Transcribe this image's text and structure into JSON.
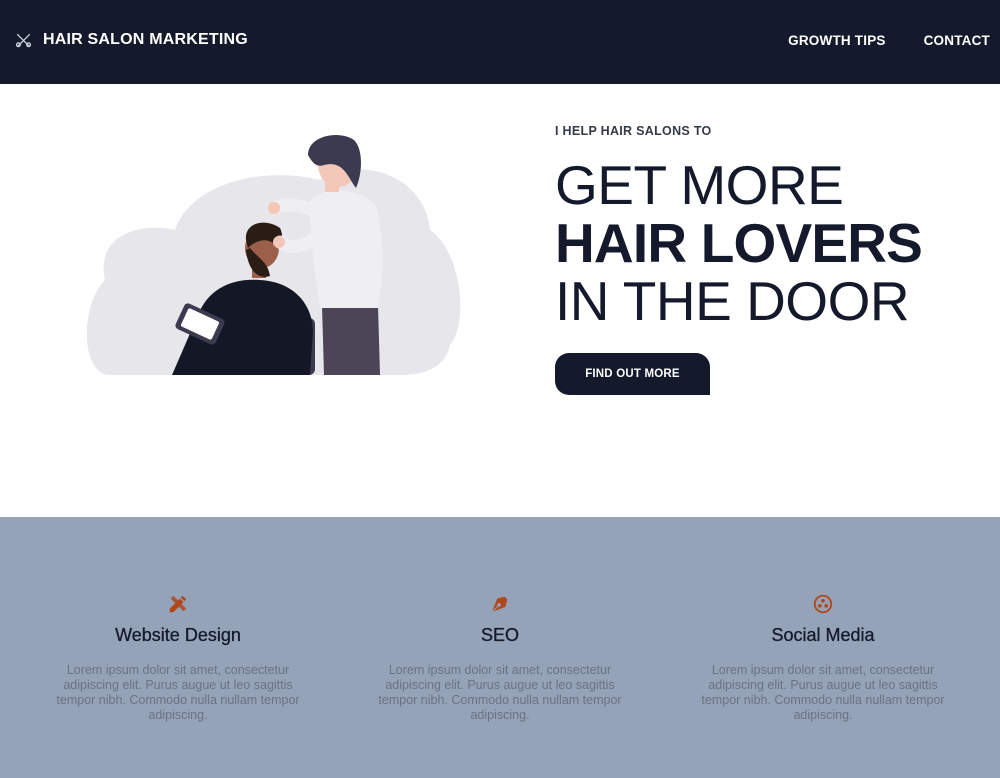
{
  "brand": {
    "name": "HAIR SALON MARKETING",
    "icon": "scissors-icon"
  },
  "nav": {
    "items": [
      {
        "label": "GROWTH TIPS"
      },
      {
        "label": "CONTACT"
      }
    ]
  },
  "hero": {
    "eyebrow": "I HELP HAIR SALONS TO",
    "headline": {
      "line1": "GET MORE",
      "line2": "HAIR LOVERS",
      "line3": "IN THE DOOR"
    },
    "cta_label": "FIND OUT MORE"
  },
  "services": [
    {
      "icon": "pencil-ruler-icon",
      "title": "Website Design",
      "description": "Lorem ipsum dolor sit amet, consectetur adipiscing elit. Purus augue ut leo sagittis tempor nibh. Commodo nulla nullam tempor adipiscing."
    },
    {
      "icon": "pen-nib-icon",
      "title": "SEO",
      "description": "Lorem ipsum dolor sit amet, consectetur adipiscing elit. Purus augue ut leo sagittis tempor nibh. Commodo nulla nullam tempor adipiscing."
    },
    {
      "icon": "people-circle-icon",
      "title": "Social Media",
      "description": "Lorem ipsum dolor sit amet, consectetur adipiscing elit. Purus augue ut leo sagittis tempor nibh. Commodo nulla nullam tempor adipiscing."
    }
  ],
  "colors": {
    "dark": "#141a2b",
    "services_bg": "#94a3b8",
    "accent": "#b1481c",
    "muted_text": "#6b7280"
  }
}
